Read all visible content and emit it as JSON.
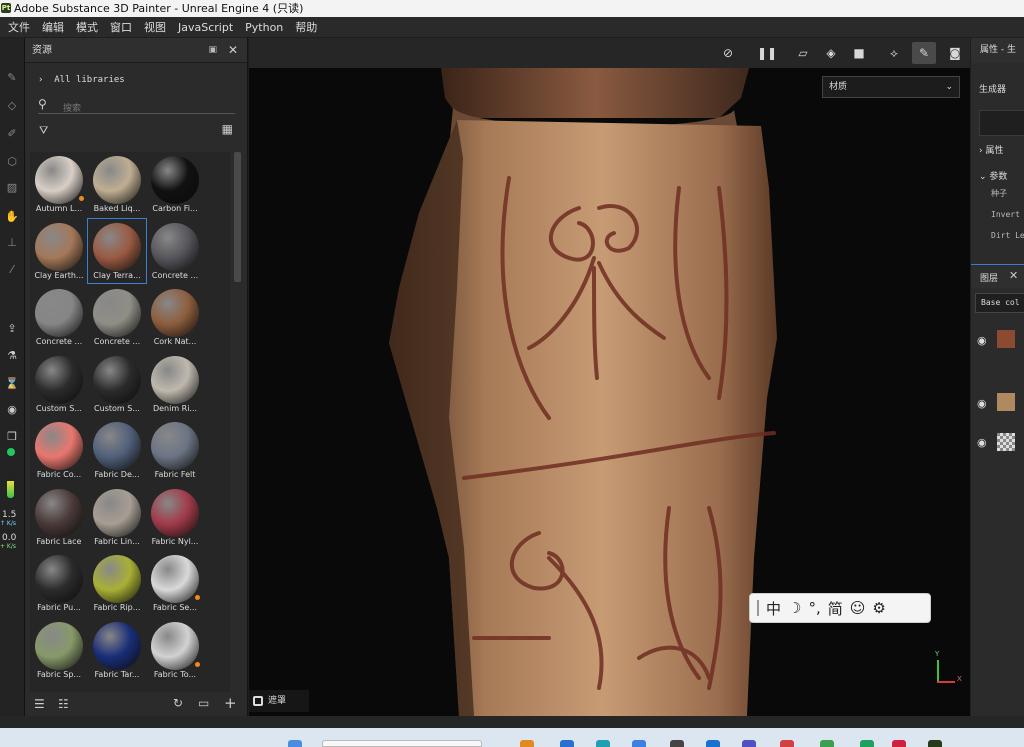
{
  "window": {
    "title": "Adobe Substance 3D Painter - Unreal Engine 4 (只读)",
    "app_badge": "Pt"
  },
  "menu": [
    "文件",
    "编辑",
    "模式",
    "窗口",
    "视图",
    "JavaScript",
    "Python",
    "帮助"
  ],
  "left_toolbar": {
    "icons": [
      "paint-brush-icon",
      "eraser-icon",
      "projection-icon",
      "geometry-mask-icon",
      "polygon-fill-icon",
      "smudge-icon",
      "clone-stamp-icon",
      "color-picker-icon",
      "bake-export-icon",
      "bake-icon",
      "bucket-icon",
      "camera-settings-icon",
      "3d-cube-icon",
      "status-green-icon",
      "gpu-meter-icon"
    ],
    "speed_up": "1.5",
    "speed_up_unit": "↑ K/s",
    "speed_down": "0.0",
    "speed_down_unit": "+ K/s",
    "status_green": "#22c55e"
  },
  "assets": {
    "title": "资源",
    "all_libraries": "All libraries",
    "search_placeholder": "搜索",
    "materials": [
      {
        "label": "Autumn L...",
        "color": "#d8cfc6",
        "dot": true
      },
      {
        "label": "Baked Liq...",
        "color": "#bfae92",
        "dot": false
      },
      {
        "label": "Carbon Fi...",
        "color": "#111111",
        "dot": false
      },
      {
        "label": "Clay Earth...",
        "color": "#a4785a",
        "dot": false
      },
      {
        "label": "Clay Terra...",
        "color": "#9a5a43",
        "dot": false,
        "selected": true
      },
      {
        "label": "Concrete ...",
        "color": "#56565c",
        "dot": false
      },
      {
        "label": "Concrete ...",
        "color": "#868686",
        "dot": false
      },
      {
        "label": "Concrete ...",
        "color": "#8f8e86",
        "dot": false
      },
      {
        "label": "Cork Nat...",
        "color": "#8e5e3e",
        "dot": false
      },
      {
        "label": "Custom S...",
        "color": "#2b2b2b",
        "dot": false
      },
      {
        "label": "Custom S...",
        "color": "#2b2b2b",
        "dot": false
      },
      {
        "label": "Denim Ri...",
        "color": "#bfb8ae",
        "dot": false
      },
      {
        "label": "Fabric Co...",
        "color": "#e8776f",
        "dot": false
      },
      {
        "label": "Fabric De...",
        "color": "#51607a",
        "dot": false
      },
      {
        "label": "Fabric Felt",
        "color": "#6c7484",
        "dot": false
      },
      {
        "label": "Fabric Lace",
        "color": "#4a3a38",
        "dot": false
      },
      {
        "label": "Fabric Lin...",
        "color": "#a79e94",
        "dot": false
      },
      {
        "label": "Fabric Nyl...",
        "color": "#a13b4a",
        "dot": false
      },
      {
        "label": "Fabric Pu...",
        "color": "#2b2b2b",
        "dot": false
      },
      {
        "label": "Fabric Rip...",
        "color": "#a9b035",
        "dot": false
      },
      {
        "label": "Fabric Se...",
        "color": "#d9d9d9",
        "dot": true
      },
      {
        "label": "Fabric Sp...",
        "color": "#87996a",
        "dot": false
      },
      {
        "label": "Fabric Tar...",
        "color": "#1a2e78",
        "dot": false
      },
      {
        "label": "Fabric To...",
        "color": "#d2d2d2",
        "dot": true
      }
    ]
  },
  "viewport": {
    "material_mode": "材质",
    "mask_label": "遮罩",
    "ime": [
      "中",
      "☽",
      "°,",
      "简",
      "☺",
      "⚙"
    ],
    "axis_y": "Y",
    "axis_x": "X"
  },
  "right_panel": {
    "properties_title": "属性 - 生",
    "generator": "生成器",
    "section_attributes": "属性",
    "section_params": "参数",
    "seed": "种子",
    "invert": "Invert",
    "dirt_level": "Dirt Le",
    "layers_title": "图层",
    "base_color": "Base col"
  }
}
